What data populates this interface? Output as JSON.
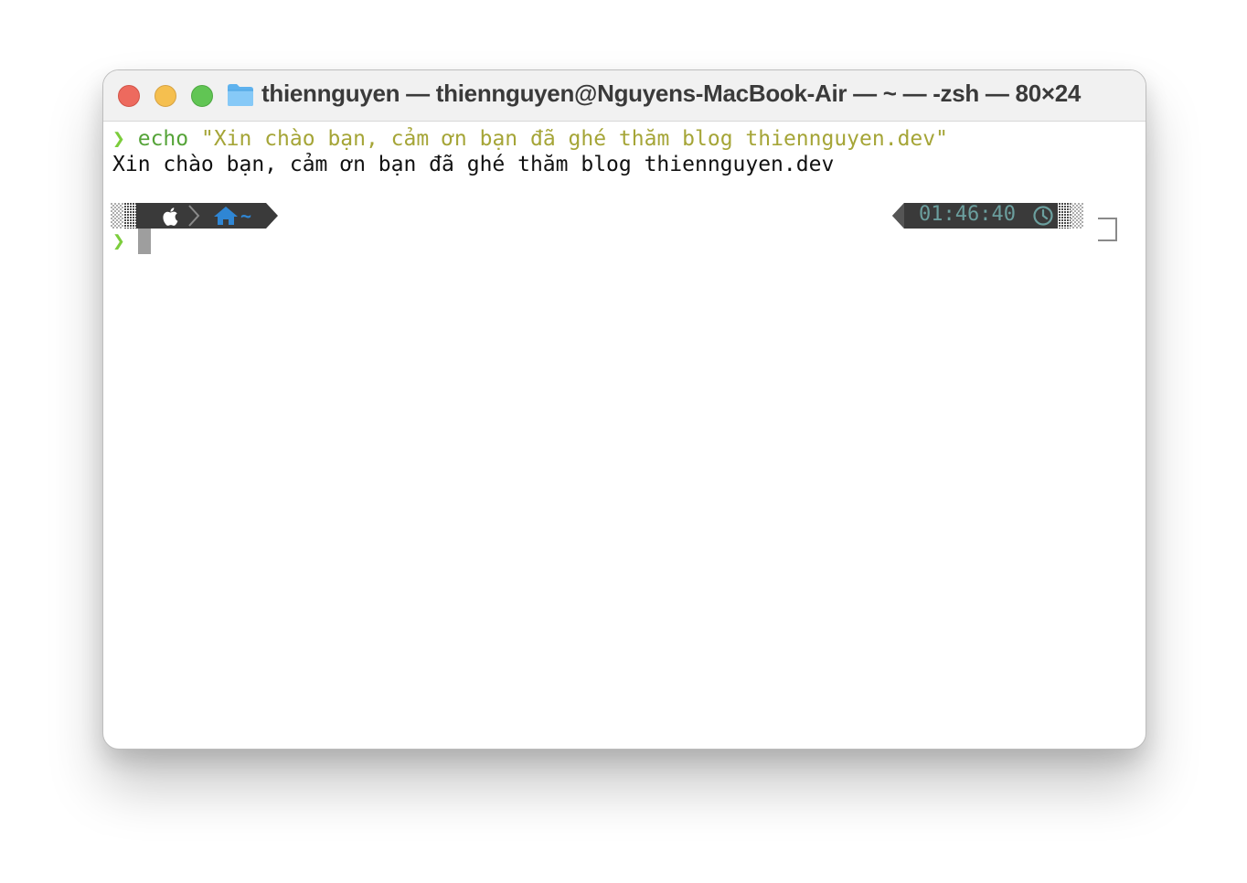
{
  "window": {
    "title": "thiennguyen — thiennguyen@Nguyens-MacBook-Air — ~ — -zsh — 80×24"
  },
  "terminal": {
    "prompt_symbol": "❯",
    "command_name": "echo",
    "command_arg": "\"Xin chào bạn, cảm ơn bạn đã ghé thăm blog thiennguyen.dev\"",
    "output": "Xin chào bạn, cảm ơn bạn đã ghé thăm blog thiennguyen.dev",
    "left_prompt": {
      "os_icon": "apple-icon",
      "separator_icon": "chevron-right-icon",
      "dir_icon": "home-icon",
      "dir": "~"
    },
    "right_prompt": {
      "time": "01:46:40",
      "time_icon": "clock-icon"
    }
  },
  "colors": {
    "prompt_green": "#7ccd3c",
    "echo_green": "#55a338",
    "string_olive": "#a5a537",
    "segment_bg": "#3a3a3a",
    "dir_blue": "#2f86d4",
    "time_teal": "#6b9f9e"
  }
}
